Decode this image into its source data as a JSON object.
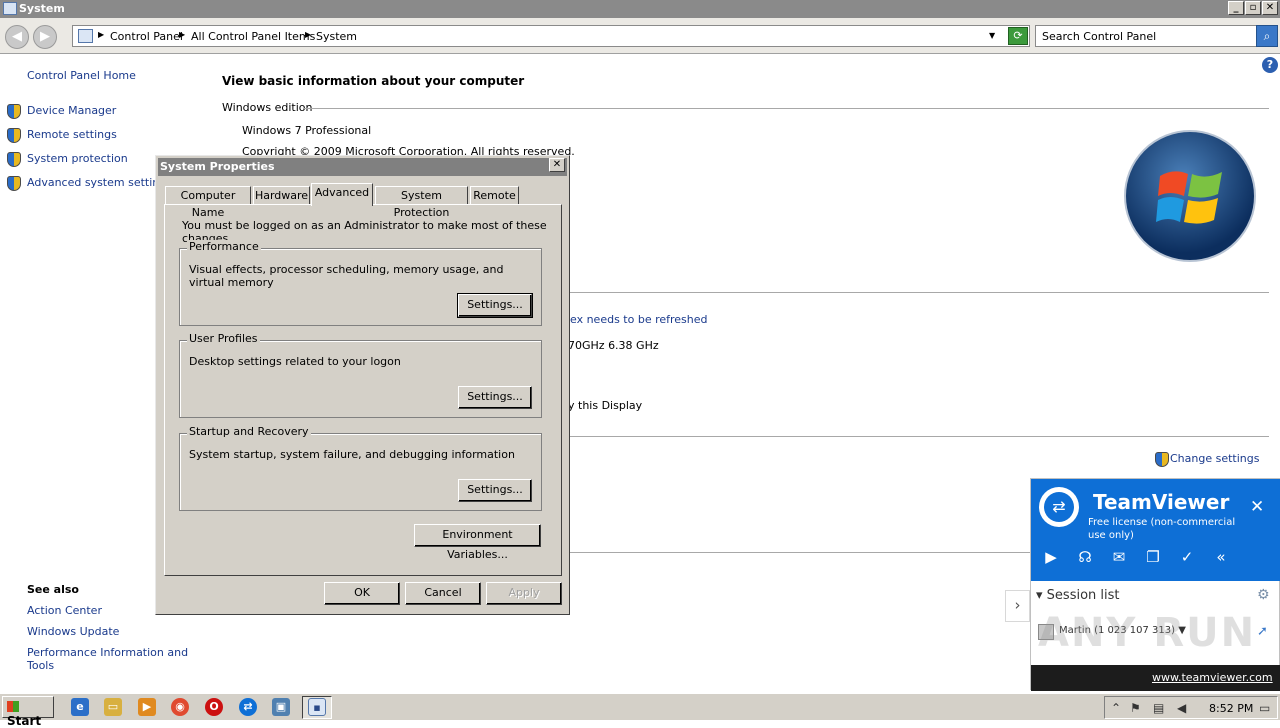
{
  "window": {
    "title": "System"
  },
  "address": {
    "crumbs": [
      "Control Panel",
      "All Control Panel Items",
      "System"
    ],
    "search_placeholder": "Search Control Panel"
  },
  "sidebar": {
    "home": "Control Panel Home",
    "items": [
      {
        "label": "Device Manager",
        "icon": "shield-icon"
      },
      {
        "label": "Remote settings",
        "icon": "shield-icon"
      },
      {
        "label": "System protection",
        "icon": "shield-icon"
      },
      {
        "label": "Advanced system settings",
        "icon": "shield-icon"
      }
    ],
    "see_also_title": "See also",
    "see_also": [
      "Action Center",
      "Windows Update",
      "Performance Information and",
      "Tools"
    ]
  },
  "main": {
    "heading": "View basic information about your computer",
    "windows_edition_label": "Windows edition",
    "edition": "Windows 7 Professional",
    "copyright": "Copyright © 2009 Microsoft Corporation.  All rights reserved.",
    "rating_link": "ex needs to be refreshed",
    "processor": "70GHz   6.38 GHz",
    "pen": "y this Display",
    "change_settings": "Change settings"
  },
  "dialog": {
    "title": "System Properties",
    "tabs": [
      "Computer Name",
      "Hardware",
      "Advanced",
      "System Protection",
      "Remote"
    ],
    "active_tab": "Advanced",
    "admin_note": "You must be logged on as an Administrator to make most of these changes.",
    "performance": {
      "title": "Performance",
      "desc": "Visual effects, processor scheduling, memory usage, and virtual memory",
      "button": "Settings..."
    },
    "profiles": {
      "title": "User Profiles",
      "desc": "Desktop settings related to your logon",
      "button": "Settings..."
    },
    "startup": {
      "title": "Startup and Recovery",
      "desc": "System startup, system failure, and debugging information",
      "button": "Settings..."
    },
    "env_button": "Environment Variables...",
    "ok": "OK",
    "cancel": "Cancel",
    "apply": "Apply"
  },
  "teamviewer": {
    "name": "TeamViewer",
    "license": "Free license (non-commercial use only)",
    "session_list": "Session list",
    "user": "Martin (1 023 107 313)",
    "link": "www.teamviewer.com",
    "brand_color": "#0e6fd6"
  },
  "watermark": "ANY RUN",
  "taskbar": {
    "start": "Start",
    "clock": "8:52 PM"
  }
}
